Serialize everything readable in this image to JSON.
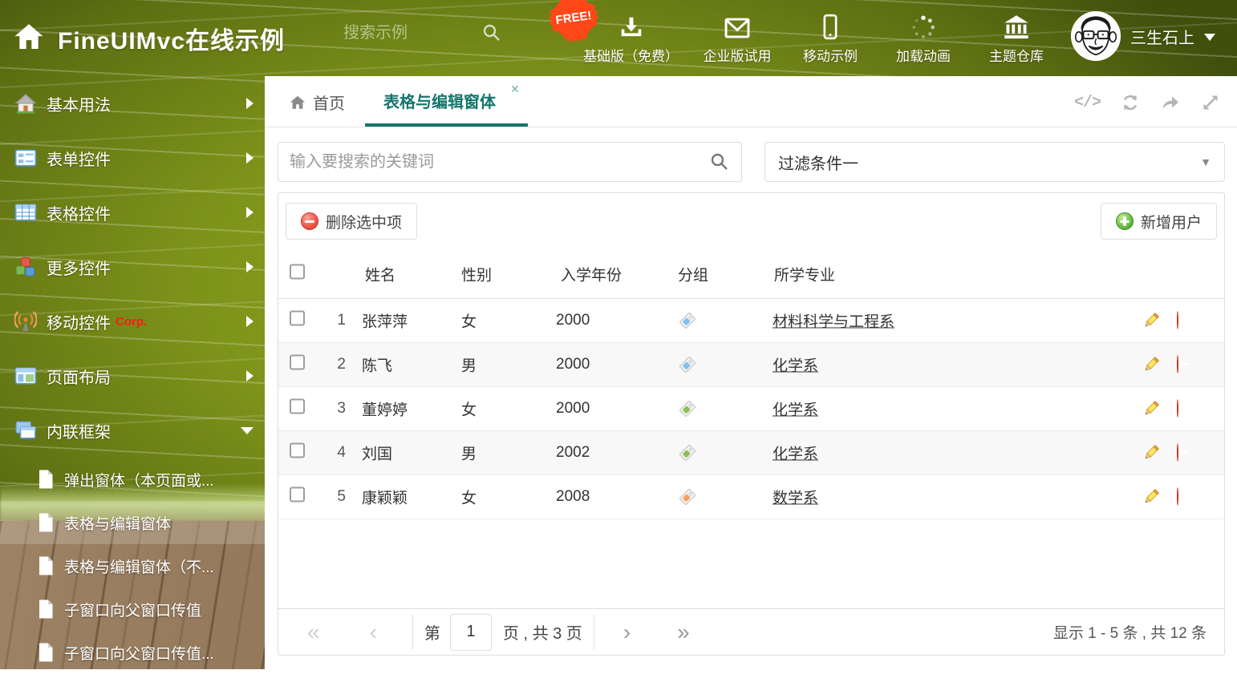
{
  "header": {
    "title": "FineUIMvc在线示例",
    "search_placeholder": "搜索示例",
    "free_badge": "FREE!",
    "nav": [
      {
        "label": "基础版（免费）"
      },
      {
        "label": "企业版试用"
      },
      {
        "label": "移动示例"
      },
      {
        "label": "加载动画"
      },
      {
        "label": "主题仓库"
      }
    ],
    "user": {
      "name": "三生石上"
    }
  },
  "sidebar": {
    "items": [
      {
        "label": "基本用法"
      },
      {
        "label": "表单控件"
      },
      {
        "label": "表格控件"
      },
      {
        "label": "更多控件"
      },
      {
        "label": "移动控件",
        "badge": "Corp."
      },
      {
        "label": "页面布局"
      },
      {
        "label": "内联框架",
        "expanded": true
      }
    ],
    "subitems": [
      {
        "label": "弹出窗体（本页面或..."
      },
      {
        "label": "表格与编辑窗体",
        "selected": true
      },
      {
        "label": "表格与编辑窗体（不..."
      },
      {
        "label": "子窗口向父窗口传值"
      },
      {
        "label": "子窗口向父窗口传值..."
      }
    ]
  },
  "tabs": {
    "home": "首页",
    "active": "表格与编辑窗体"
  },
  "filters": {
    "search_placeholder": "输入要搜索的关键词",
    "filter_selected": "过滤条件一"
  },
  "toolbar": {
    "delete_label": "删除选中项",
    "add_label": "新增用户"
  },
  "table": {
    "columns": [
      "姓名",
      "性别",
      "入学年份",
      "分组",
      "所学专业"
    ],
    "rows": [
      {
        "num": "1",
        "name": "张萍萍",
        "gender": "女",
        "year": "2000",
        "tag": "#7fc1ee",
        "major": "材料科学与工程系"
      },
      {
        "num": "2",
        "name": "陈飞",
        "gender": "男",
        "year": "2000",
        "tag": "#7fc1ee",
        "major": "化学系"
      },
      {
        "num": "3",
        "name": "董婷婷",
        "gender": "女",
        "year": "2000",
        "tag": "#8cc152",
        "major": "化学系"
      },
      {
        "num": "4",
        "name": "刘国",
        "gender": "男",
        "year": "2002",
        "tag": "#8cc152",
        "major": "化学系"
      },
      {
        "num": "5",
        "name": "康颖颖",
        "gender": "女",
        "year": "2008",
        "tag": "#f6a25c",
        "major": "数学系"
      }
    ]
  },
  "pagination": {
    "page_prefix": "第",
    "current_page": "1",
    "page_suffix": "页 , 共 3 页",
    "summary": "显示 1 - 5 条 , 共 12 条"
  },
  "icons": {
    "pagination_first": "«",
    "pagination_prev": "‹",
    "pagination_next": "›",
    "pagination_last": "»",
    "tab_close": "✕",
    "dropdown_caret": "▼",
    "code": "</>"
  },
  "colors": {
    "accent_teal": "#14756c",
    "free_badge": "#ff4718",
    "tag_blue": "#7fc1ee",
    "tag_green": "#8cc152",
    "tag_orange": "#f6a25c",
    "delete_red": "#ef5b4b",
    "add_green": "#6cc04a"
  }
}
